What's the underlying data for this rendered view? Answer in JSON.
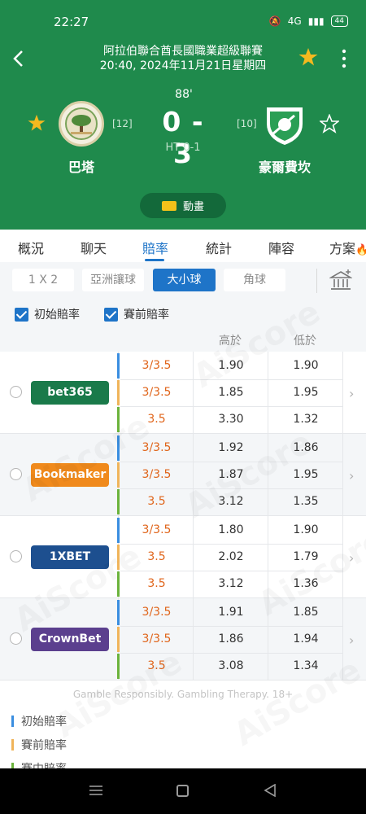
{
  "status_bar": {
    "time": "22:27",
    "signal": "4G",
    "battery": "44"
  },
  "match": {
    "league": "阿拉伯聯合酋長國職業超級聯賽",
    "datetime": "20:40, 2024年11月21日星期四",
    "minute": "88'",
    "score": "0 - 3",
    "halftime": "HT 0-1",
    "home": {
      "name": "巴塔",
      "rank": "[12]"
    },
    "away": {
      "name": "豪爾費坎",
      "rank": "[10]"
    },
    "animation_label": "動畫"
  },
  "tabs": [
    "概況",
    "聊天",
    "賠率",
    "統計",
    "陣容",
    "方案"
  ],
  "active_tab": "賠率",
  "market_buttons": [
    "1 X 2",
    "亞洲讓球",
    "大小球",
    "角球"
  ],
  "active_market": "大小球",
  "checkboxes": {
    "initial": "初始賠率",
    "pre_match": "賽前賠率"
  },
  "table_headers": {
    "over": "高於",
    "under": "低於"
  },
  "bookmakers": [
    {
      "name": "bet365",
      "color": "#1a7a4a",
      "rows": [
        {
          "line": "3/3.5",
          "over": "1.90",
          "under": "1.90"
        },
        {
          "line": "3/3.5",
          "over": "1.85",
          "under": "1.95"
        },
        {
          "line": "3.5",
          "over": "3.30",
          "under": "1.32"
        }
      ]
    },
    {
      "name": "Bookmaker",
      "color": "#f08a1c",
      "rows": [
        {
          "line": "3/3.5",
          "over": "1.92",
          "under": "1.86"
        },
        {
          "line": "3/3.5",
          "over": "1.87",
          "under": "1.95"
        },
        {
          "line": "3.5",
          "over": "3.12",
          "under": "1.35"
        }
      ]
    },
    {
      "name": "1XBET",
      "color": "#1d4f8f",
      "rows": [
        {
          "line": "3/3.5",
          "over": "1.80",
          "under": "1.90"
        },
        {
          "line": "3.5",
          "over": "2.02",
          "under": "1.79"
        },
        {
          "line": "3.5",
          "over": "3.12",
          "under": "1.36"
        }
      ]
    },
    {
      "name": "CrownBet",
      "color": "#5b3f8e",
      "rows": [
        {
          "line": "3/3.5",
          "over": "1.91",
          "under": "1.85"
        },
        {
          "line": "3/3.5",
          "over": "1.86",
          "under": "1.94"
        },
        {
          "line": "3.5",
          "over": "3.08",
          "under": "1.34"
        }
      ]
    }
  ],
  "legend": [
    {
      "label": "初始賠率",
      "color": "#3a8ee0"
    },
    {
      "label": "賽前賠率",
      "color": "#f0b45a"
    },
    {
      "label": "賽中賠率",
      "color": "#6bb33c"
    }
  ],
  "gamble_note": "Gamble Responsibly. Gambling Therapy. 18+",
  "watermark": "AiScore",
  "colors": {
    "header_green": "#1f8a4c",
    "accent_blue": "#1e74c8",
    "line_orange": "#e0651b"
  }
}
